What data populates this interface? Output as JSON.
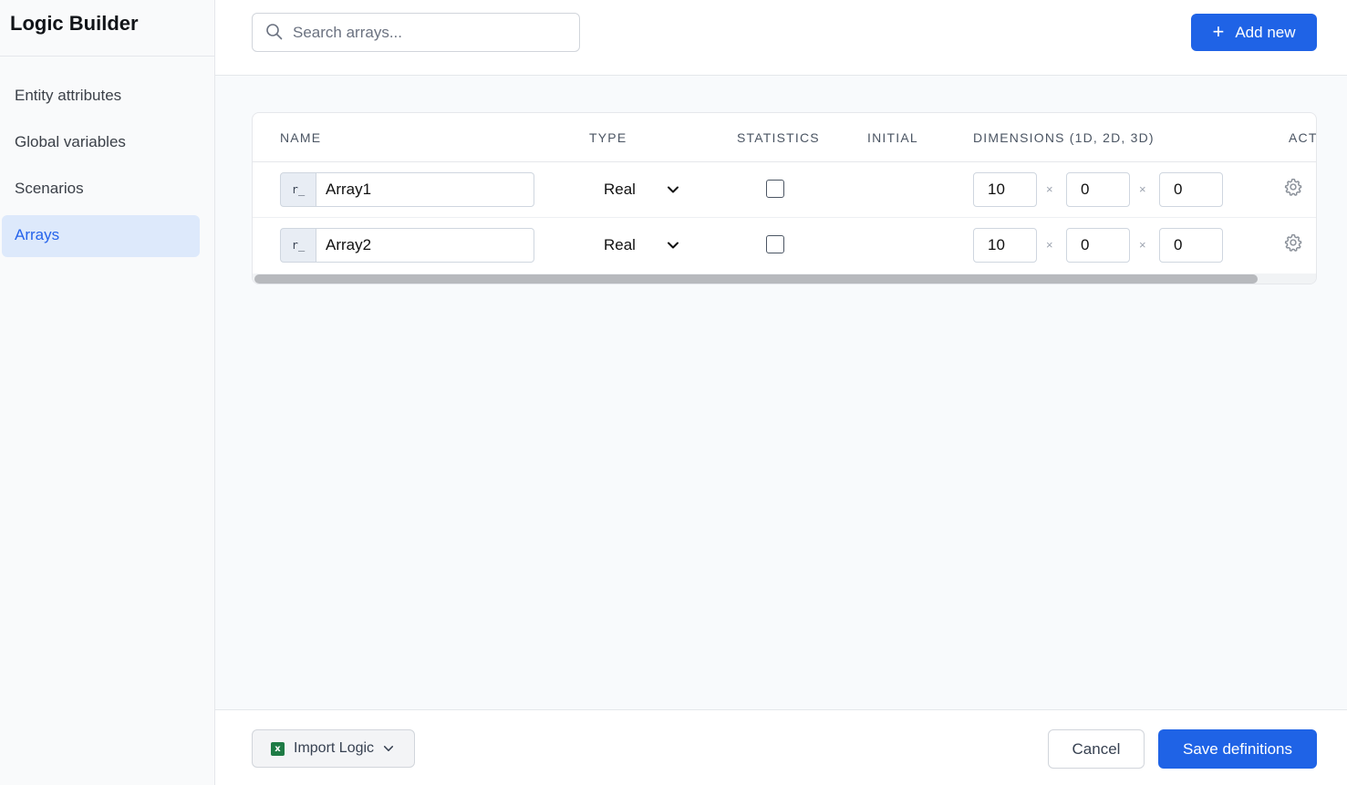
{
  "app": {
    "title": "Logic Builder"
  },
  "sidebar": {
    "items": [
      {
        "label": "Entity attributes",
        "active": false
      },
      {
        "label": "Global variables",
        "active": false
      },
      {
        "label": "Scenarios",
        "active": false
      },
      {
        "label": "Arrays",
        "active": true
      }
    ]
  },
  "search": {
    "placeholder": "Search arrays...",
    "value": ""
  },
  "toolbar": {
    "add_label": "Add new"
  },
  "table": {
    "columns": [
      "NAME",
      "TYPE",
      "STATISTICS",
      "INITIAL",
      "DIMENSIONS (1D, 2D, 3D)",
      "ACT"
    ],
    "rows": [
      {
        "prefix": "r_",
        "name": "Array1",
        "type": "Real",
        "statistics": false,
        "initial": "",
        "dims": [
          "10",
          "0",
          "0"
        ]
      },
      {
        "prefix": "r_",
        "name": "Array2",
        "type": "Real",
        "statistics": false,
        "initial": "",
        "dims": [
          "10",
          "0",
          "0"
        ]
      }
    ],
    "dim_separator": "×"
  },
  "footer": {
    "import_label": "Import Logic",
    "cancel_label": "Cancel",
    "save_label": "Save definitions"
  },
  "colors": {
    "accent": "#1f63e6",
    "active_bg": "#dde9fb",
    "excel_green": "#1e7b45"
  },
  "icons": [
    "search-icon",
    "plus-icon",
    "chevron-down-icon",
    "gear-icon",
    "excel-icon"
  ]
}
